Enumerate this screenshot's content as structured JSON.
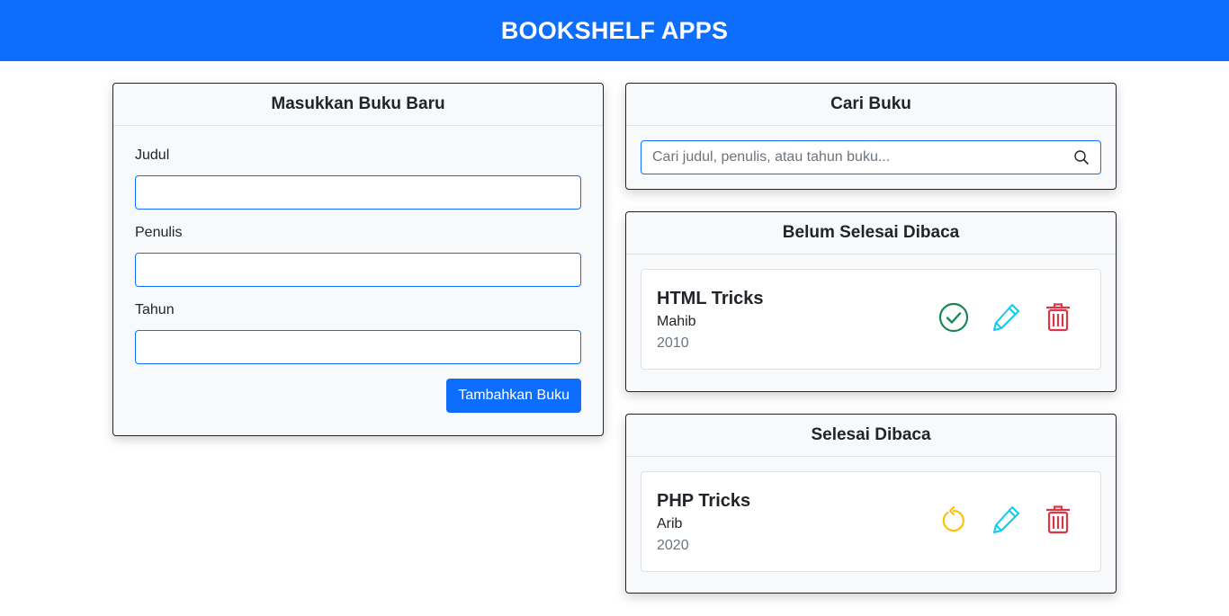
{
  "navbar": {
    "title": "BOOKSHELF APPS"
  },
  "form": {
    "heading": "Masukkan Buku Baru",
    "fields": [
      {
        "label": "Judul",
        "value": ""
      },
      {
        "label": "Penulis",
        "value": ""
      },
      {
        "label": "Tahun",
        "value": ""
      }
    ],
    "submit_label": "Tambahkan Buku"
  },
  "search": {
    "heading": "Cari Buku",
    "placeholder": "Cari judul, penulis, atau tahun buku...",
    "value": "",
    "icon": "search-icon"
  },
  "unread": {
    "heading": "Belum Selesai Dibaca",
    "books": [
      {
        "title": "HTML Tricks",
        "author": "Mahib",
        "year": "2010",
        "actions": [
          "check-circle-icon",
          "pencil-icon",
          "trash-icon"
        ]
      }
    ]
  },
  "read": {
    "heading": "Selesai Dibaca",
    "books": [
      {
        "title": "PHP Tricks",
        "author": "Arib",
        "year": "2020",
        "actions": [
          "undo-icon",
          "pencil-icon",
          "trash-icon"
        ]
      }
    ]
  },
  "colors": {
    "primary": "#0d6efd",
    "success": "#198754",
    "info": "#0dcaf0",
    "warning": "#ffc107",
    "danger": "#dc3545"
  }
}
